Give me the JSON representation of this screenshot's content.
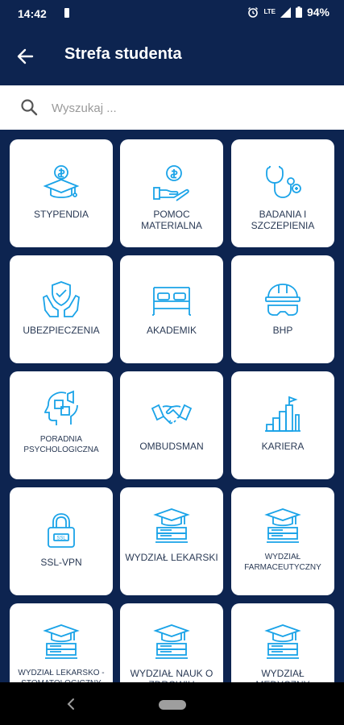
{
  "status": {
    "time": "14:42",
    "network": "LTE",
    "battery": "94%"
  },
  "header": {
    "title": "Strefa studenta"
  },
  "search": {
    "placeholder": "Wyszukaj ..."
  },
  "tiles": [
    {
      "label": "STYPENDIA",
      "icon": "scholarship-coin-icon"
    },
    {
      "label": "POMOC MATERIALNA",
      "icon": "hand-coin-icon"
    },
    {
      "label": "BADANIA I SZCZEPIENIA",
      "icon": "stethoscope-icon"
    },
    {
      "label": "UBEZPIECZENIA",
      "icon": "shield-hands-icon"
    },
    {
      "label": "AKADEMIK",
      "icon": "bed-icon"
    },
    {
      "label": "BHP",
      "icon": "hardhat-goggles-icon"
    },
    {
      "label": "PORADNIA PSYCHOLOGICZNA",
      "icon": "head-puzzle-icon"
    },
    {
      "label": "OMBUDSMAN",
      "icon": "handshake-icon"
    },
    {
      "label": "KARIERA",
      "icon": "career-stairs-icon"
    },
    {
      "label": "SSL-VPN",
      "icon": "padlock-icon"
    },
    {
      "label": "WYDZIAŁ LEKARSKI",
      "icon": "graduation-cap-icon"
    },
    {
      "label": "WYDZIAŁ FARMACEUTYCZNY",
      "icon": "graduation-cap-icon"
    },
    {
      "label": "WYDZIAŁ LEKARSKO - STOMATOLOGICZNY",
      "icon": "graduation-cap-icon"
    },
    {
      "label": "WYDZIAŁ NAUK O ZDROWIU",
      "icon": "graduation-cap-icon"
    },
    {
      "label": "WYDZIAŁ MEDYCZNY",
      "icon": "graduation-cap-icon"
    }
  ],
  "colors": {
    "header": "#0d2450",
    "icon": "#1aa3e8",
    "tile": "#ffffff",
    "label": "#2a3a55"
  }
}
